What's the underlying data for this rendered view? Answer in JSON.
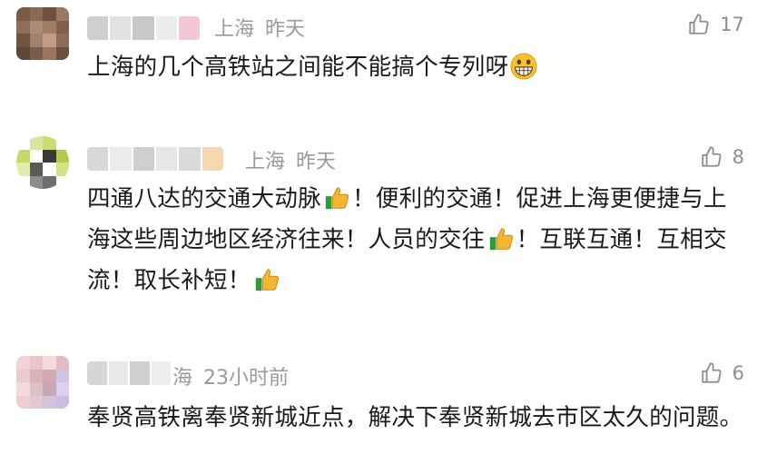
{
  "comments": [
    {
      "location": "上海",
      "time": "昨天",
      "likes": "17",
      "text": "上海的几个高铁站之间能不能搞个专列呀",
      "avatar_colors": [
        "#7a5a48",
        "#8a6a55",
        "#6d5040",
        "#9a7a66",
        "#8e6e58",
        "#b08a72",
        "#a07c66",
        "#7e604e",
        "#6f5444",
        "#a2826c",
        "#c49c82",
        "#8c6c58",
        "#5e4638",
        "#7a5c4a",
        "#9a7660",
        "#6a4e3e"
      ]
    },
    {
      "location": "上海",
      "time": "昨天",
      "likes": "8",
      "text_parts": [
        "四通八达的交通大动脉",
        "！便利的交通！促进上海更便捷与上海这些周边地区经济往来！人员的交往",
        "！互联互通！互相交流！取长补短！"
      ],
      "avatar_colors": [
        "#ffffff",
        "#d9e4a0",
        "#cddc72",
        "#ffffff",
        "#c9d86a",
        "#ffffff",
        "#3a3a3a",
        "#b7c94c",
        "#e3ebb0",
        "#5a5a5a",
        "#ffffff",
        "#d5e284",
        "#ffffff",
        "#8c8c8c",
        "#6e6e6e",
        "#ffffff"
      ]
    },
    {
      "location": "海",
      "time": "23小时前",
      "likes": "6",
      "text": "奉贤高铁离奉贤新城近点，解决下奉贤新城去市区太久的问题。",
      "avatar_colors": [
        "#f2d2d6",
        "#e9c6cc",
        "#f5dadd",
        "#e2bcc4",
        "#e6cbd3",
        "#d8b3bb",
        "#d3a8b2",
        "#cfc4e3",
        "#f1d9dd",
        "#dcc0c8",
        "#c7a8b4",
        "#d9d2ec",
        "#eecdd2",
        "#e4c8cf",
        "#d6c2d8",
        "#cabde0"
      ]
    }
  ],
  "icons": {
    "like": "thumbs-up-outline-icon",
    "emoji1": "grinning-face-icon",
    "emoji2": "thumbs-up-emoji-icon"
  }
}
